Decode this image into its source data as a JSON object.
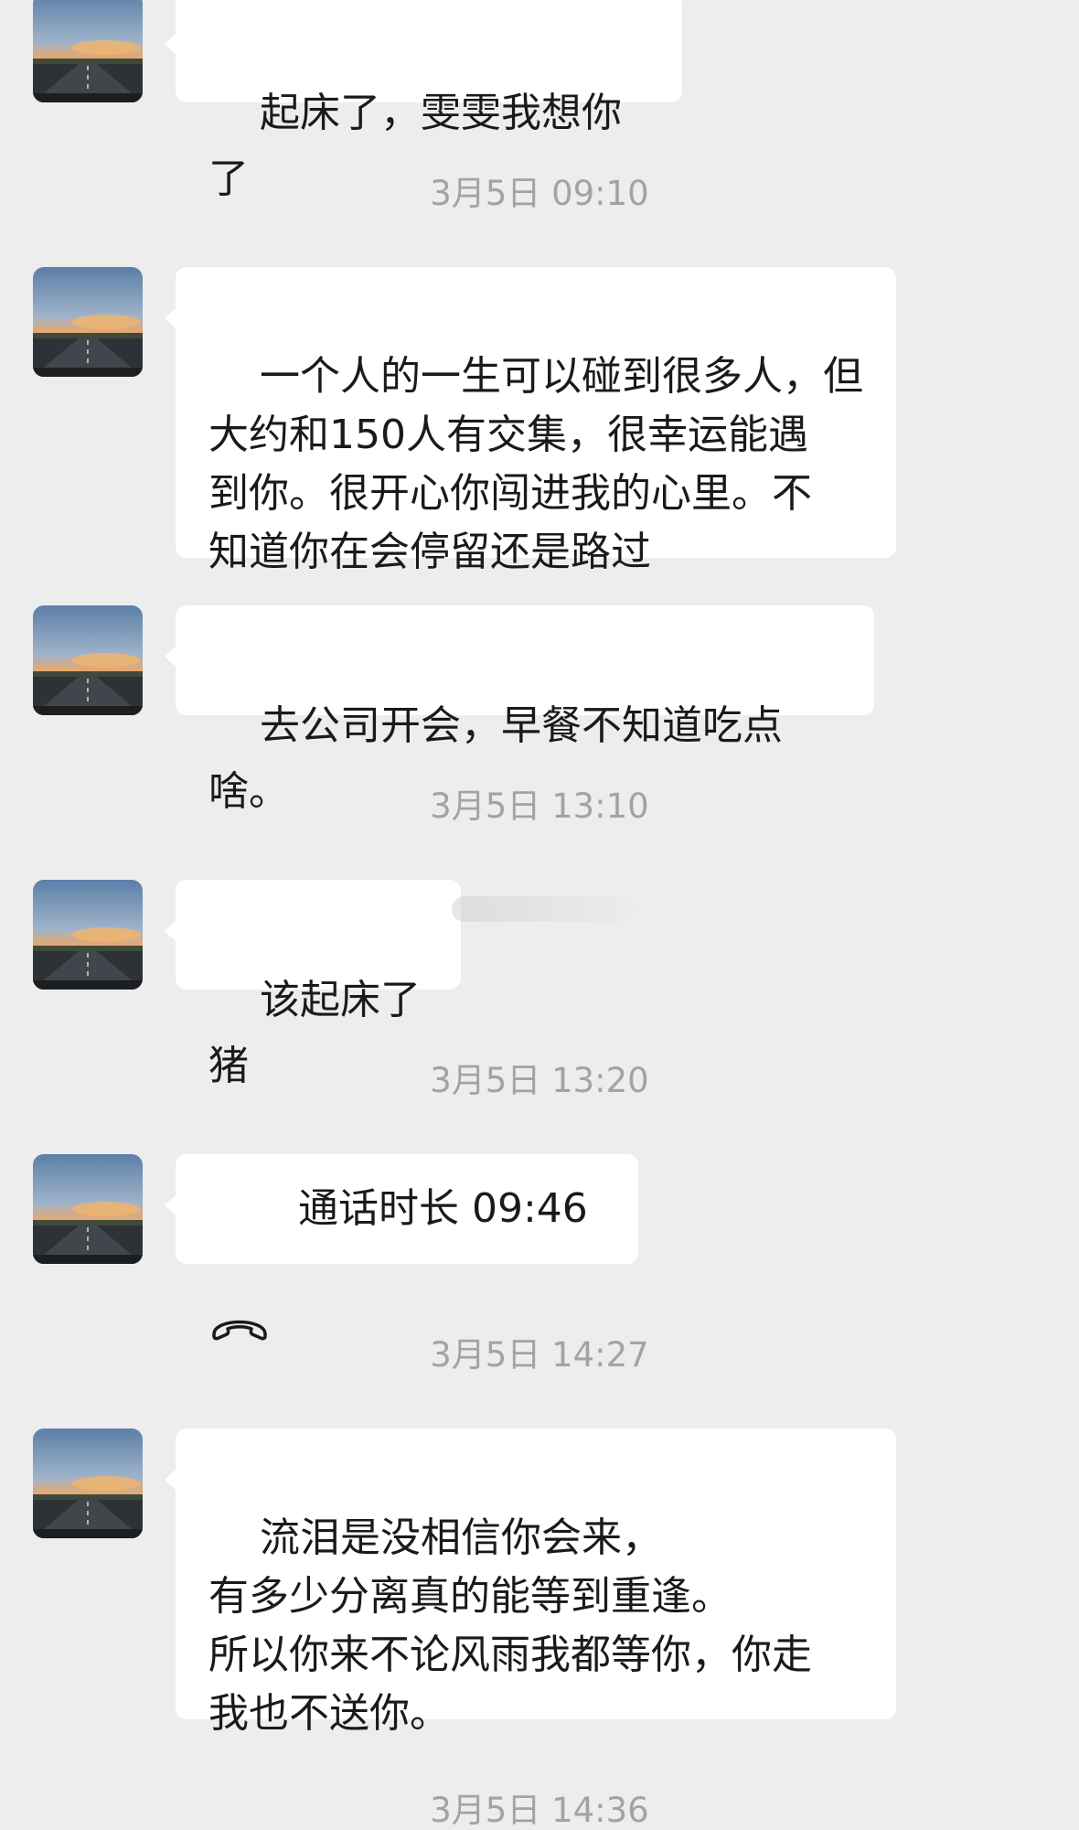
{
  "colors": {
    "background": "#ededed",
    "bubble": "#ffffff",
    "text": "#1a1a1a",
    "timestamp": "#a3a3a3"
  },
  "messages": [
    {
      "text": "起床了，雯雯我想你了"
    },
    {
      "timestamp": "3月5日 09:10"
    },
    {
      "text": "一个人的一生可以碰到很多人，但\n大约和150人有交集，很幸运能遇\n到你。很开心你闯进我的心里。不\n知道你在会停留还是路过"
    },
    {
      "text": "去公司开会，早餐不知道吃点啥。"
    },
    {
      "timestamp": "3月5日 13:10"
    },
    {
      "text": "该起床了猪"
    },
    {
      "timestamp": "3月5日 13:20"
    },
    {
      "call_icon": "phone-hangup-icon",
      "text": "通话时长 09:46"
    },
    {
      "timestamp": "3月5日 14:27"
    },
    {
      "text": "流泪是没相信你会来，\n有多少分离真的能等到重逢。\n所以你来不论风雨我都等你，你走\n我也不送你。"
    },
    {
      "timestamp": "3月5日 14:36"
    }
  ]
}
